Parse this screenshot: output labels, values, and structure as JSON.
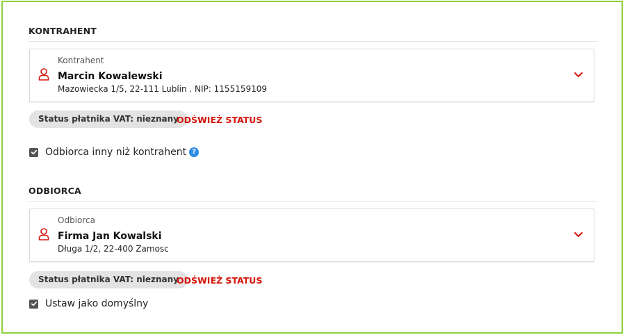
{
  "kontrahent_section": {
    "title": "KONTRAHENT",
    "card": {
      "label": "Kontrahent",
      "name": "Marcin Kowalewski",
      "address": "Mazowiecka 1/5, 22-111 Lublin . NIP: 1155159109"
    },
    "vat_status": "Status płatnika VAT: nieznany",
    "refresh_label": "ODŚWIEŻ STATUS"
  },
  "recipient_toggle": {
    "label": "Odbiorca inny niż kontrahent",
    "checked": true,
    "help_glyph": "?"
  },
  "odbiorca_section": {
    "title": "ODBIORCA",
    "card": {
      "label": "Odbiorca",
      "name": "Firma Jan Kowalski",
      "address": "Długa 1/2, 22-400 Zamosc"
    },
    "vat_status": "Status płatnika VAT: nieznany",
    "refresh_label": "ODŚWIEŻ STATUS"
  },
  "default_toggle": {
    "label": "Ustaw jako domyślny",
    "checked": true
  },
  "colors": {
    "frame_border": "#8bd13a",
    "accent_red": "#d4150b",
    "help_blue": "#2b8de6",
    "pill_bg": "#e3e3e3"
  },
  "icons": {
    "person": "person-outline-icon",
    "chevron": "chevron-down-icon",
    "check": "check-icon",
    "help": "help-icon"
  }
}
